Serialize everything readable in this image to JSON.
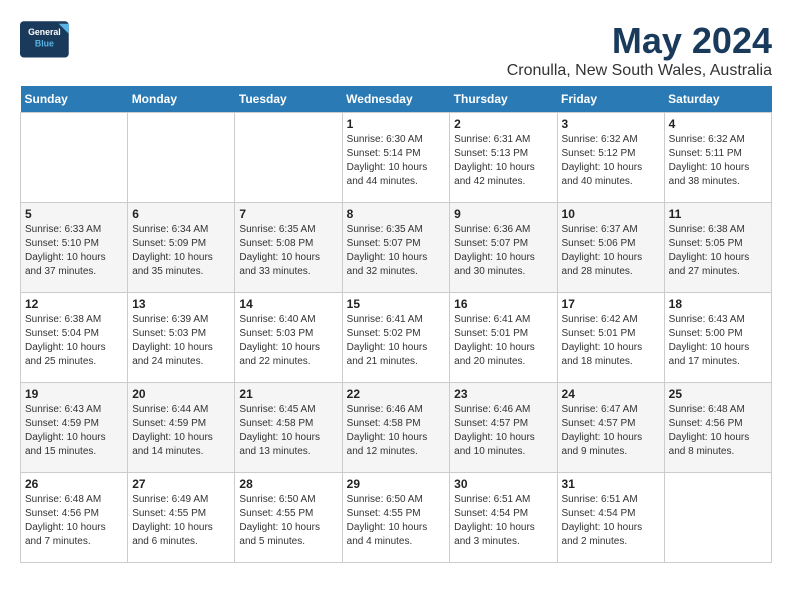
{
  "header": {
    "logo_line1": "General",
    "logo_line2": "Blue",
    "title": "May 2024",
    "subtitle": "Cronulla, New South Wales, Australia"
  },
  "weekdays": [
    "Sunday",
    "Monday",
    "Tuesday",
    "Wednesday",
    "Thursday",
    "Friday",
    "Saturday"
  ],
  "weeks": [
    [
      {
        "day": "",
        "detail": ""
      },
      {
        "day": "",
        "detail": ""
      },
      {
        "day": "",
        "detail": ""
      },
      {
        "day": "1",
        "detail": "Sunrise: 6:30 AM\nSunset: 5:14 PM\nDaylight: 10 hours\nand 44 minutes."
      },
      {
        "day": "2",
        "detail": "Sunrise: 6:31 AM\nSunset: 5:13 PM\nDaylight: 10 hours\nand 42 minutes."
      },
      {
        "day": "3",
        "detail": "Sunrise: 6:32 AM\nSunset: 5:12 PM\nDaylight: 10 hours\nand 40 minutes."
      },
      {
        "day": "4",
        "detail": "Sunrise: 6:32 AM\nSunset: 5:11 PM\nDaylight: 10 hours\nand 38 minutes."
      }
    ],
    [
      {
        "day": "5",
        "detail": "Sunrise: 6:33 AM\nSunset: 5:10 PM\nDaylight: 10 hours\nand 37 minutes."
      },
      {
        "day": "6",
        "detail": "Sunrise: 6:34 AM\nSunset: 5:09 PM\nDaylight: 10 hours\nand 35 minutes."
      },
      {
        "day": "7",
        "detail": "Sunrise: 6:35 AM\nSunset: 5:08 PM\nDaylight: 10 hours\nand 33 minutes."
      },
      {
        "day": "8",
        "detail": "Sunrise: 6:35 AM\nSunset: 5:07 PM\nDaylight: 10 hours\nand 32 minutes."
      },
      {
        "day": "9",
        "detail": "Sunrise: 6:36 AM\nSunset: 5:07 PM\nDaylight: 10 hours\nand 30 minutes."
      },
      {
        "day": "10",
        "detail": "Sunrise: 6:37 AM\nSunset: 5:06 PM\nDaylight: 10 hours\nand 28 minutes."
      },
      {
        "day": "11",
        "detail": "Sunrise: 6:38 AM\nSunset: 5:05 PM\nDaylight: 10 hours\nand 27 minutes."
      }
    ],
    [
      {
        "day": "12",
        "detail": "Sunrise: 6:38 AM\nSunset: 5:04 PM\nDaylight: 10 hours\nand 25 minutes."
      },
      {
        "day": "13",
        "detail": "Sunrise: 6:39 AM\nSunset: 5:03 PM\nDaylight: 10 hours\nand 24 minutes."
      },
      {
        "day": "14",
        "detail": "Sunrise: 6:40 AM\nSunset: 5:03 PM\nDaylight: 10 hours\nand 22 minutes."
      },
      {
        "day": "15",
        "detail": "Sunrise: 6:41 AM\nSunset: 5:02 PM\nDaylight: 10 hours\nand 21 minutes."
      },
      {
        "day": "16",
        "detail": "Sunrise: 6:41 AM\nSunset: 5:01 PM\nDaylight: 10 hours\nand 20 minutes."
      },
      {
        "day": "17",
        "detail": "Sunrise: 6:42 AM\nSunset: 5:01 PM\nDaylight: 10 hours\nand 18 minutes."
      },
      {
        "day": "18",
        "detail": "Sunrise: 6:43 AM\nSunset: 5:00 PM\nDaylight: 10 hours\nand 17 minutes."
      }
    ],
    [
      {
        "day": "19",
        "detail": "Sunrise: 6:43 AM\nSunset: 4:59 PM\nDaylight: 10 hours\nand 15 minutes."
      },
      {
        "day": "20",
        "detail": "Sunrise: 6:44 AM\nSunset: 4:59 PM\nDaylight: 10 hours\nand 14 minutes."
      },
      {
        "day": "21",
        "detail": "Sunrise: 6:45 AM\nSunset: 4:58 PM\nDaylight: 10 hours\nand 13 minutes."
      },
      {
        "day": "22",
        "detail": "Sunrise: 6:46 AM\nSunset: 4:58 PM\nDaylight: 10 hours\nand 12 minutes."
      },
      {
        "day": "23",
        "detail": "Sunrise: 6:46 AM\nSunset: 4:57 PM\nDaylight: 10 hours\nand 10 minutes."
      },
      {
        "day": "24",
        "detail": "Sunrise: 6:47 AM\nSunset: 4:57 PM\nDaylight: 10 hours\nand 9 minutes."
      },
      {
        "day": "25",
        "detail": "Sunrise: 6:48 AM\nSunset: 4:56 PM\nDaylight: 10 hours\nand 8 minutes."
      }
    ],
    [
      {
        "day": "26",
        "detail": "Sunrise: 6:48 AM\nSunset: 4:56 PM\nDaylight: 10 hours\nand 7 minutes."
      },
      {
        "day": "27",
        "detail": "Sunrise: 6:49 AM\nSunset: 4:55 PM\nDaylight: 10 hours\nand 6 minutes."
      },
      {
        "day": "28",
        "detail": "Sunrise: 6:50 AM\nSunset: 4:55 PM\nDaylight: 10 hours\nand 5 minutes."
      },
      {
        "day": "29",
        "detail": "Sunrise: 6:50 AM\nSunset: 4:55 PM\nDaylight: 10 hours\nand 4 minutes."
      },
      {
        "day": "30",
        "detail": "Sunrise: 6:51 AM\nSunset: 4:54 PM\nDaylight: 10 hours\nand 3 minutes."
      },
      {
        "day": "31",
        "detail": "Sunrise: 6:51 AM\nSunset: 4:54 PM\nDaylight: 10 hours\nand 2 minutes."
      },
      {
        "day": "",
        "detail": ""
      }
    ]
  ]
}
